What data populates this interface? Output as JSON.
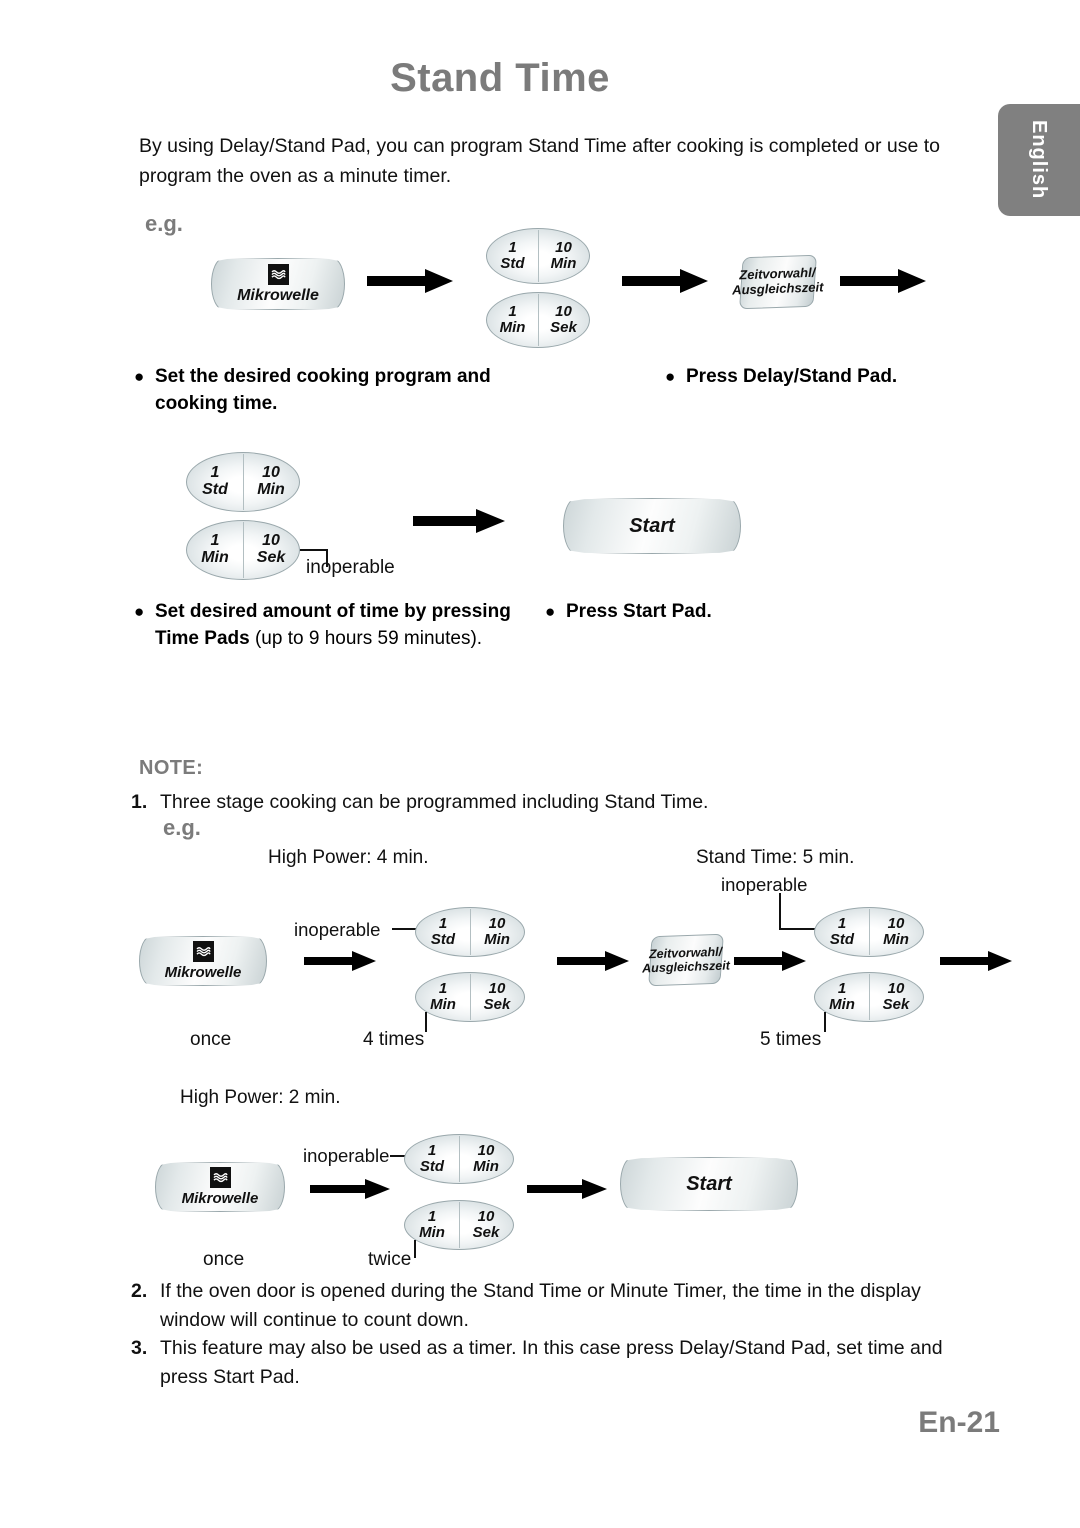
{
  "header": {
    "title": "Stand Time",
    "language_tab": "English"
  },
  "intro": "By using Delay/Stand Pad, you can program Stand Time after cooking is completed or use to program the oven as a minute timer.",
  "labels": {
    "eg": "e.g.",
    "note": "NOTE:",
    "page_number": "En-21",
    "inoperable": "inoperable",
    "once": "once",
    "twice": "twice",
    "four_times": "4 times",
    "five_times": "5 times",
    "high_power_4": "High Power: 4 min.",
    "high_power_2": "High Power: 2 min.",
    "stand_time_5": "Stand Time: 5 min."
  },
  "pads": {
    "microwave_label": "Mikrowelle",
    "microwave_icon": "microwave-wave-icon",
    "start_label": "Start",
    "delay_stand_line1": "Zeitvorwahl/",
    "delay_stand_line2": "Ausgleichszeit",
    "time_pad_hour": {
      "top": "1",
      "bottom": "Std"
    },
    "time_pad_tenmin": {
      "top": "10",
      "bottom": "Min"
    },
    "time_pad_min": {
      "top": "1",
      "bottom": "Min"
    },
    "time_pad_tensec": {
      "top": "10",
      "bottom": "Sek"
    }
  },
  "steps": {
    "step1_bold": "Set the desired cooking program and cooking time.",
    "step2_bold": "Press Delay/Stand Pad.",
    "step3_bold_a": "Set desired amount of time by pressing Time Pads",
    "step3_reg": " (up to 9 hours 59 minutes).",
    "step4_bold": "Press Start Pad."
  },
  "notes": [
    {
      "num": "1.",
      "text": "Three stage cooking can be programmed including Stand Time."
    },
    {
      "num": "2.",
      "text": "If the oven door is opened during the Stand Time or Minute Timer, the time in the display window will continue to count down."
    },
    {
      "num": "3.",
      "text": "This feature may also be used as a timer. In this case press Delay/Stand Pad, set time and press Start Pad."
    }
  ],
  "colors": {
    "heading_gray": "#7b7b7b",
    "tab_gray": "#808080",
    "text_black": "#111111"
  }
}
